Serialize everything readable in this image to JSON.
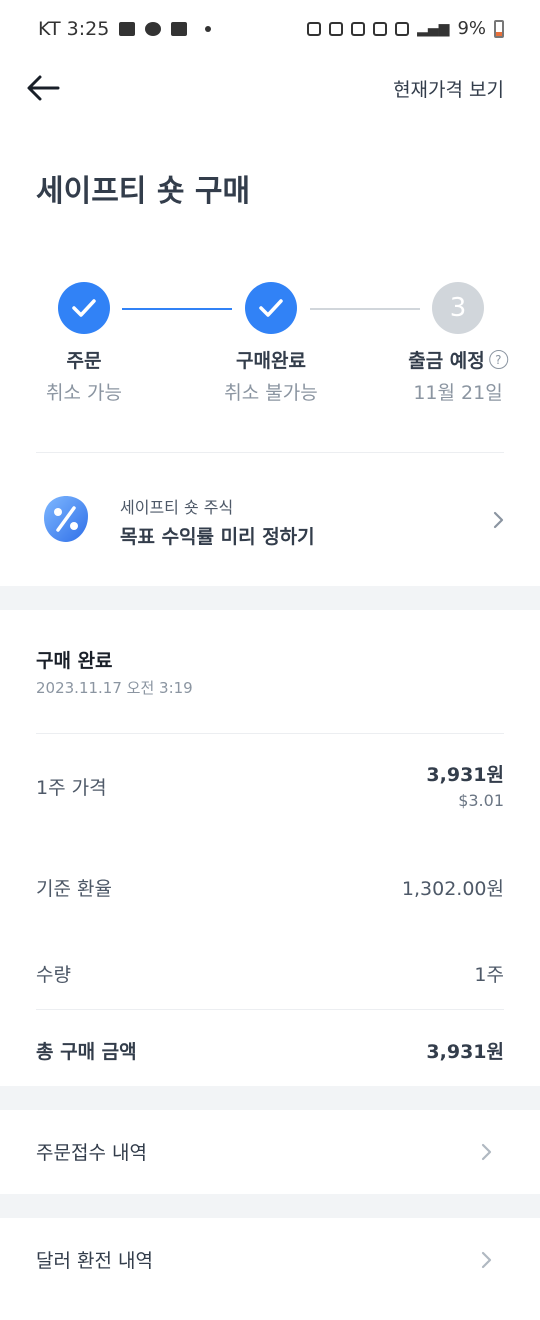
{
  "status_bar": {
    "carrier_time": "KT 3:25",
    "battery": "9%"
  },
  "header": {
    "back_icon": "arrow-left-icon",
    "current_price_link": "현재가격 보기"
  },
  "page_title": "세이프티 숏 구매",
  "stepper": {
    "steps": [
      {
        "label": "주문",
        "sub": "취소 가능",
        "state": "done"
      },
      {
        "label": "구매완료",
        "sub": "취소 불가능",
        "state": "done"
      },
      {
        "label": "출금 예정",
        "sub": "11월 21일",
        "state": "pending",
        "number": "3"
      }
    ],
    "active_color": "#3182f6",
    "inactive_color": "#d1d6db"
  },
  "promo": {
    "icon": "percent-badge-icon",
    "subtitle": "세이프티 숏 주식",
    "title": "목표 수익률 미리 정하기"
  },
  "purchase": {
    "title": "구매 완료",
    "datetime": "2023.11.17 오전 3:19",
    "price_label": "1주 가격",
    "price_krw": "3,931원",
    "price_usd": "$3.01",
    "fx_label": "기준 환율",
    "fx_value": "1,302.00원",
    "qty_label": "수량",
    "qty_value": "1주",
    "total_label": "총 구매 금액",
    "total_value": "3,931원"
  },
  "links": {
    "order_history": "주문접수 내역",
    "fx_history": "달러 환전 내역"
  }
}
